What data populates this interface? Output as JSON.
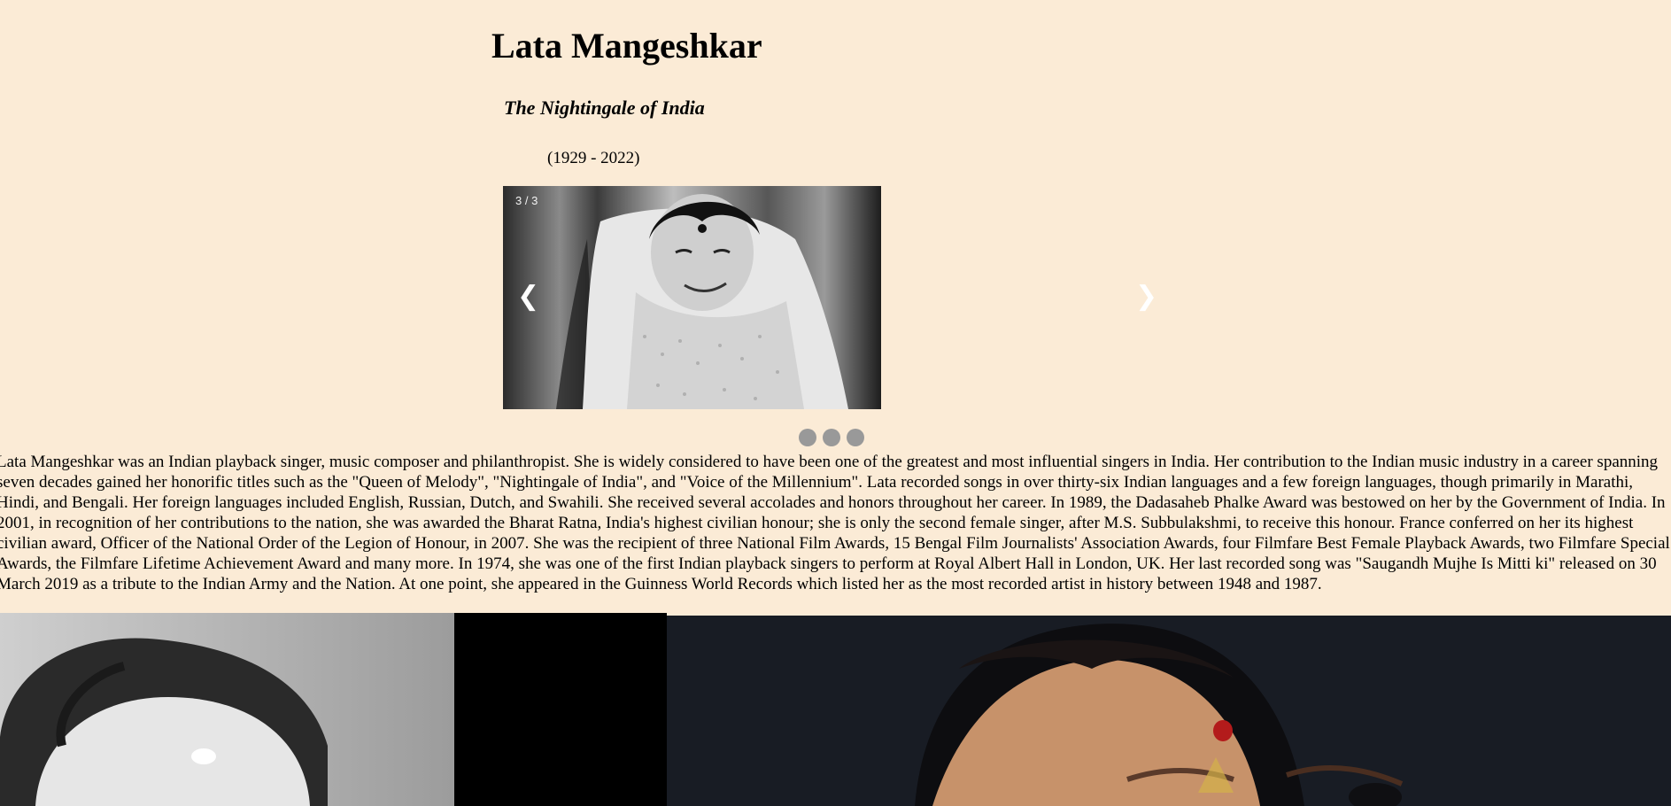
{
  "header": {
    "title": "Lata Mangeshkar",
    "subtitle": "The Nightingale of India",
    "years": "(1929 - 2022)"
  },
  "slideshow": {
    "counter": "3 / 3",
    "prev_label": "❮",
    "next_label": "❯",
    "current_slide": 3,
    "total_slides": 3
  },
  "biography": "Lata Mangeshkar was an Indian playback singer, music composer and philanthropist. She is widely considered to have been one of the greatest and most influential singers in India. Her contribution to the Indian music industry in a career spanning seven decades gained her honorific titles such as the \"Queen of Melody\", \"Nightingale of India\", and \"Voice of the Millennium\". Lata recorded songs in over thirty-six Indian languages and a few foreign languages, though primarily in Marathi, Hindi, and Bengali. Her foreign languages included English, Russian, Dutch, and Swahili. She received several accolades and honors throughout her career. In 1989, the Dadasaheb Phalke Award was bestowed on her by the Government of India. In 2001, in recognition of her contributions to the nation, she was awarded the Bharat Ratna, India's highest civilian honour; she is only the second female singer, after M.S. Subbulakshmi, to receive this honour. France conferred on her its highest civilian award, Officer of the National Order of the Legion of Honour, in 2007. She was the recipient of three National Film Awards, 15 Bengal Film Journalists' Association Awards, four Filmfare Best Female Playback Awards, two Filmfare Special Awards, the Filmfare Lifetime Achievement Award and many more. In 1974, she was one of the first Indian playback singers to perform at Royal Albert Hall in London, UK. Her last recorded song was \"Saugandh Mujhe Is Mitti ki\" released on 30 March 2019 as a tribute to the Indian Army and the Nation. At one point, she appeared in the Guinness World Records which listed her as the most recorded artist in history between 1948 and 1987."
}
